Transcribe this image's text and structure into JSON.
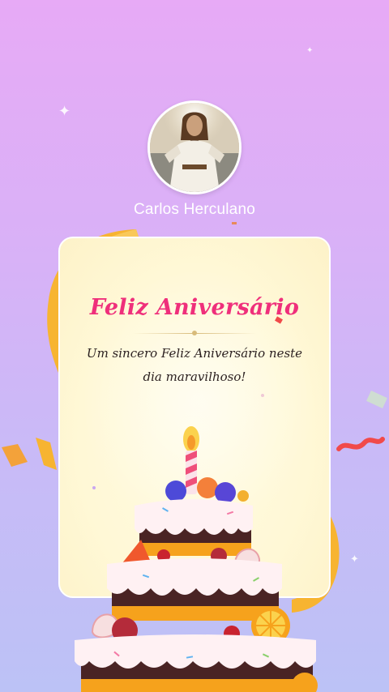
{
  "user": {
    "name": "Carlos Herculano"
  },
  "card": {
    "title": "Feliz Aniversário",
    "message": "Um sincero Feliz Aniversário neste dia maravilhoso!"
  },
  "colors": {
    "background_top": "#e7aaf6",
    "background_bottom": "#bcc2f6",
    "title": "#ef2f7b",
    "card": "#fff8d6",
    "ribbon": "#f7b431"
  },
  "icons": [
    "avatar-portrait",
    "sparkle-icon",
    "ribbon-decoration",
    "birthday-cake-illustration",
    "candle-icon"
  ]
}
